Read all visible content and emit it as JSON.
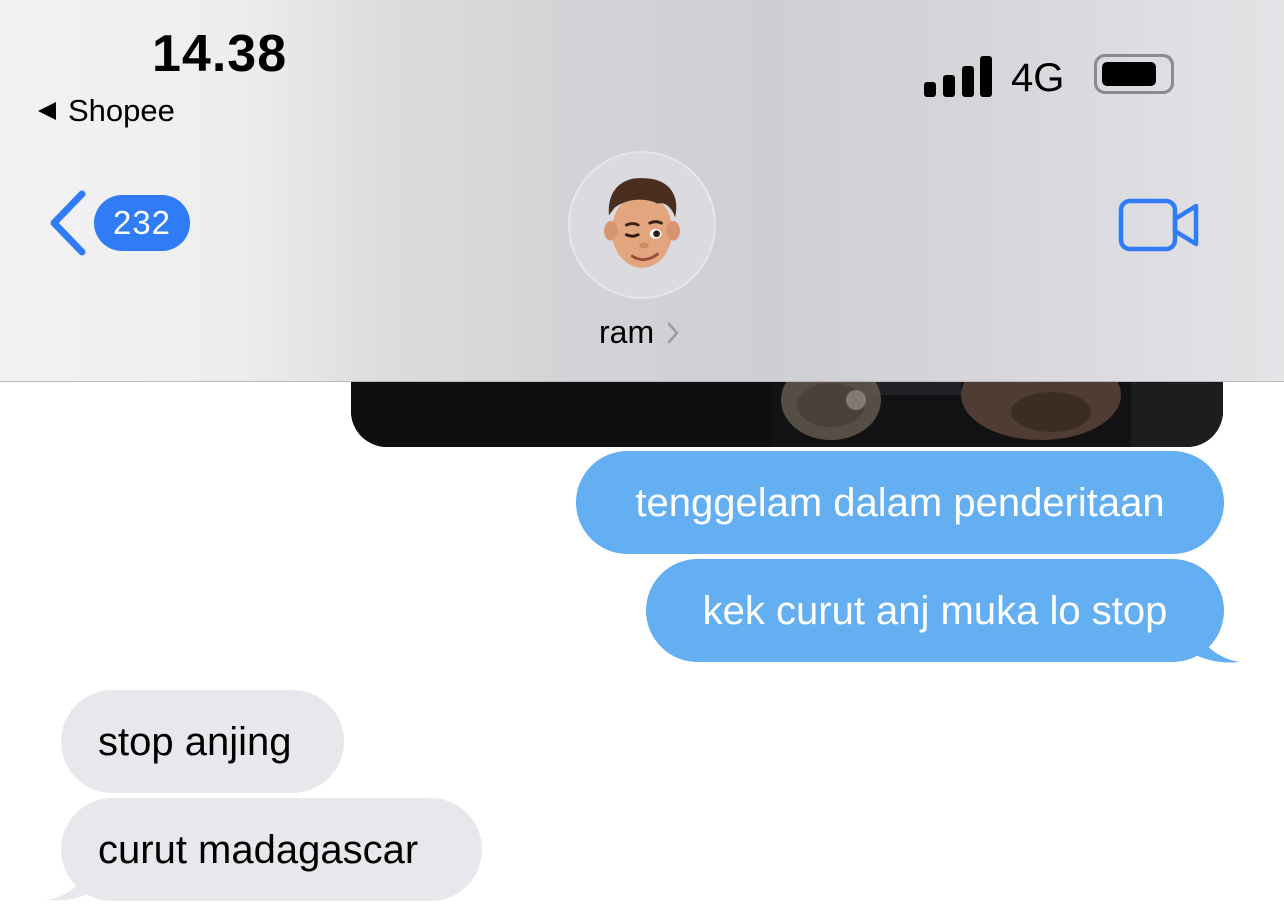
{
  "status_bar": {
    "time": "14.38",
    "back_app_label": "Shopee",
    "network": "4G",
    "signal_bars": 4,
    "battery_level": 0.85
  },
  "nav": {
    "unread_count": "232",
    "contact_name": "ram"
  },
  "messages": [
    {
      "direction": "outgoing",
      "type": "photo"
    },
    {
      "direction": "outgoing",
      "text": "tenggelam dalam penderitaan"
    },
    {
      "direction": "outgoing",
      "text": "kek curut anj muka lo stop"
    },
    {
      "direction": "incoming",
      "text": "stop anjing"
    },
    {
      "direction": "incoming",
      "text": "curut madagascar"
    }
  ],
  "colors": {
    "accent": "#2f7cf6",
    "outgoing_bubble": "#64aef2",
    "incoming_bubble": "#e8e8ec"
  }
}
